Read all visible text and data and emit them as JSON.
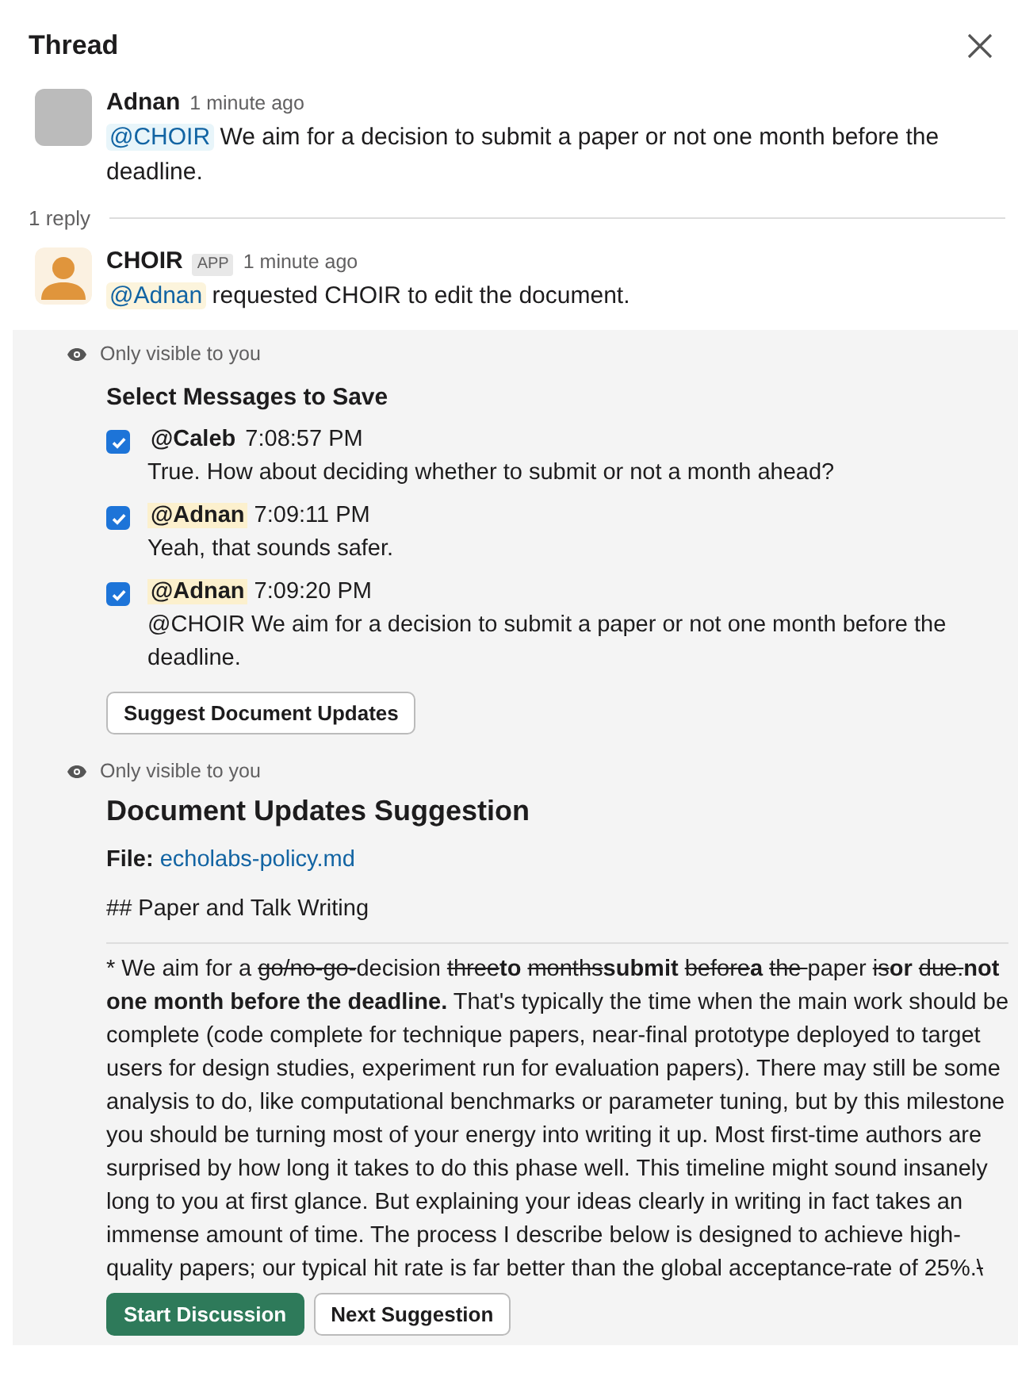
{
  "header": {
    "title": "Thread"
  },
  "messages": [
    {
      "author": "Adnan",
      "time": "1 minute ago",
      "avatar": {
        "kind": "photo"
      },
      "mention": {
        "text": "@CHOIR",
        "kind": "app"
      },
      "text": "We aim for a decision to submit a paper or not one month before the deadline."
    },
    {
      "author": "CHOIR",
      "badge": "APP",
      "time": "1 minute ago",
      "avatar": {
        "kind": "silhouette"
      },
      "mention": {
        "text": "@Adnan",
        "kind": "user"
      },
      "text": "requested CHOIR to edit the document."
    }
  ],
  "reply_count": "1 reply",
  "save_block": {
    "notice": "Only visible to you",
    "title": "Select Messages to Save",
    "items": [
      {
        "checked": true,
        "author": "@Caleb",
        "highlighted": false,
        "time": "7:08:57 PM",
        "text": "True. How about deciding whether to submit or not a month ahead?"
      },
      {
        "checked": true,
        "author": "@Adnan",
        "highlighted": true,
        "time": "7:09:11 PM",
        "text": "Yeah, that sounds safer."
      },
      {
        "checked": true,
        "author": "@Adnan",
        "highlighted": true,
        "time": "7:09:20 PM",
        "text": "@CHOIR We aim for a decision to submit a paper or not one month before the deadline."
      }
    ],
    "button": "Suggest Document Updates"
  },
  "suggestion_block": {
    "notice": "Only visible to you",
    "title": "Document Updates Suggestion",
    "file_label": "File:",
    "file_link": "echolabs-policy.md",
    "heading": "## Paper and Talk Writing",
    "diff": [
      {
        "kind": "plain",
        "text": "* We aim for a "
      },
      {
        "kind": "deleted",
        "text": "go/no-go-"
      },
      {
        "kind": "plain",
        "text": "decision "
      },
      {
        "kind": "deleted",
        "text": "three"
      },
      {
        "kind": "inserted",
        "text": "to "
      },
      {
        "kind": "deleted",
        "text": "months"
      },
      {
        "kind": "inserted",
        "text": "submit "
      },
      {
        "kind": "deleted",
        "text": "before"
      },
      {
        "kind": "inserted",
        "text": "a "
      },
      {
        "kind": "deleted",
        "text": "the "
      },
      {
        "kind": "plain",
        "text": "paper "
      },
      {
        "kind": "deleted",
        "text": "is"
      },
      {
        "kind": "inserted",
        "text": "or "
      },
      {
        "kind": "deleted",
        "text": "due."
      },
      {
        "kind": "inserted",
        "text": "not one month before the deadline."
      },
      {
        "kind": "plain",
        "text": " That's typically the time when the main work should be complete (code complete for technique papers, near-final prototype deployed to target users for design studies, experiment run for evaluation papers). There may still be some analysis to do, like computational benchmarks or parameter tuning, but by this milestone you should be turning most of your energy into writing it up. Most first-time authors are surprised by how long it takes to do this phase well. This timeline might sound insanely long to you at first glance. But explaining your ideas clearly in writing in fact takes an immense amount of time. The process I describe below is designed to achieve high-quality papers; our typical hit rate is far better than the global acceptance"
      },
      {
        "kind": "deleted_space"
      },
      {
        "kind": "plain",
        "text": "rate of 25%."
      },
      {
        "kind": "deleted",
        "text": "\\"
      }
    ],
    "buttons": [
      {
        "label": "Start Discussion",
        "kind": "primary"
      },
      {
        "label": "Next Suggestion",
        "kind": "secondary"
      }
    ]
  }
}
